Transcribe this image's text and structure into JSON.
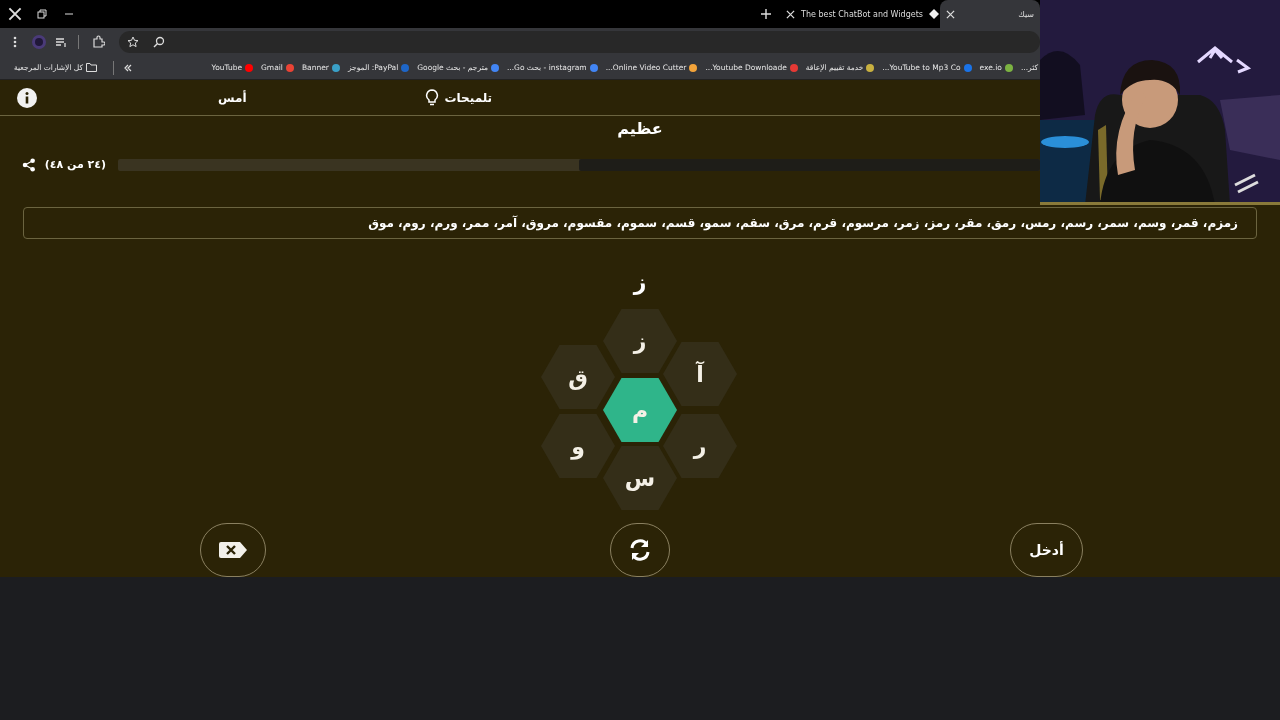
{
  "tabs": [
    {
      "title": "سيك",
      "selected": true
    },
    {
      "title": "The best ChatBot and Widgets",
      "selected": false
    }
  ],
  "bookmarks": [
    {
      "label": "كثر..."
    },
    {
      "label": "exe.io",
      "color": "#7cb342"
    },
    {
      "label": "YouTube to Mp3 Co...",
      "color": "#1a73e8"
    },
    {
      "label": "خدمة تقييم الإعاقة",
      "color": "#c8b040"
    },
    {
      "label": "Youtube Downloade...",
      "color": "#e53935"
    },
    {
      "label": "Online Video Cutter...",
      "color": "#f2a33a"
    },
    {
      "label": "instagram - بحث Go...",
      "color": "#4285f4"
    },
    {
      "label": "مترجم - بحث Google",
      "color": "#4285f4"
    },
    {
      "label": "PayPal: الموجز",
      "color": "#1e66c8"
    },
    {
      "label": "Banner",
      "color": "#3aa0c8"
    },
    {
      "label": "Gmail",
      "color": "#ea4335"
    },
    {
      "label": "YouTube",
      "color": "#ff0000"
    }
  ],
  "all_bookmarks": "كل الإشارات المرجعية",
  "game": {
    "header": {
      "yesterday": "أمس",
      "hints": "تلميحات"
    },
    "rank": "عظيم",
    "progress": {
      "label": "(٢٤ من ٤٨)",
      "level": 0.5
    },
    "found_words": "زمزم، قمر، وسم، سمر، رسم، رمس، رمق، مقر، رمز، زمر، مرسوم، قرم، مرق، سقم، سمو، قسم، سموم، مقسوم، مروق، آمر، ممر، ورم، روم، موق",
    "input": "ز",
    "letters": [
      {
        "letter": "ز",
        "kind": "outer"
      },
      {
        "letter": "آ",
        "kind": "outer"
      },
      {
        "letter": "ق",
        "kind": "outer"
      },
      {
        "letter": "م",
        "kind": "center"
      },
      {
        "letter": "ر",
        "kind": "outer"
      },
      {
        "letter": "و",
        "kind": "outer"
      },
      {
        "letter": "س",
        "kind": "outer"
      }
    ],
    "enter_button": "أدخل"
  }
}
